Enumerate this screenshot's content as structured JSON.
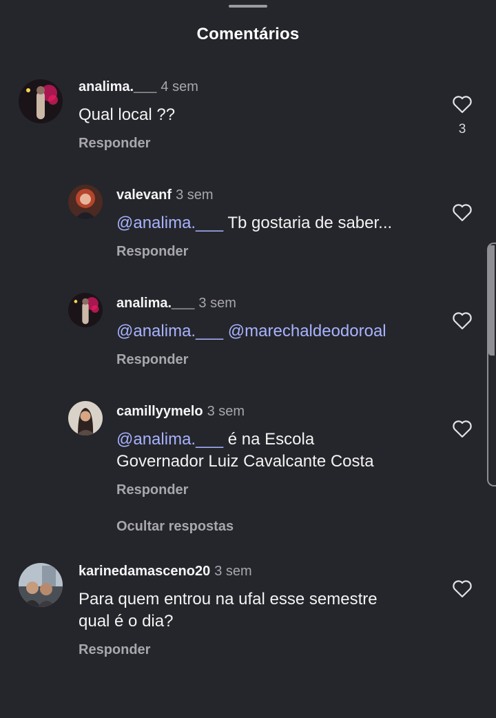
{
  "sheet": {
    "title": "Comentários"
  },
  "comments": [
    {
      "user": "analima.___",
      "time": "4 sem",
      "text": "Qual local ??",
      "reply_label": "Responder",
      "likes": "3"
    },
    {
      "user": "valevanf",
      "time": "3 sem",
      "mention": "@analima.___",
      "text": " Tb gostaria de saber...",
      "reply_label": "Responder"
    },
    {
      "user": "analima.___",
      "time": "3 sem",
      "mention": "@analima.___",
      "mention2": "@marechaldeodoroal",
      "reply_label": "Responder"
    },
    {
      "user": "camillyymelo",
      "time": "3 sem",
      "mention": "@analima.___",
      "text": " é na Escola",
      "text2": "Governador Luiz Cavalcante Costa",
      "reply_label": "Responder"
    },
    {
      "user": "karinedamasceno20",
      "time": "3 sem",
      "text": "Para quem entrou na ufal esse semestre",
      "text2": "qual é o dia?",
      "reply_label": "Responder"
    }
  ],
  "thread": {
    "hide_replies_label": "Ocultar respostas"
  },
  "icons": {
    "like": "heart-outline-icon"
  },
  "colors": {
    "background": "#25262b",
    "mention": "#a8b3ff",
    "secondary_text": "#a7a7ad"
  }
}
